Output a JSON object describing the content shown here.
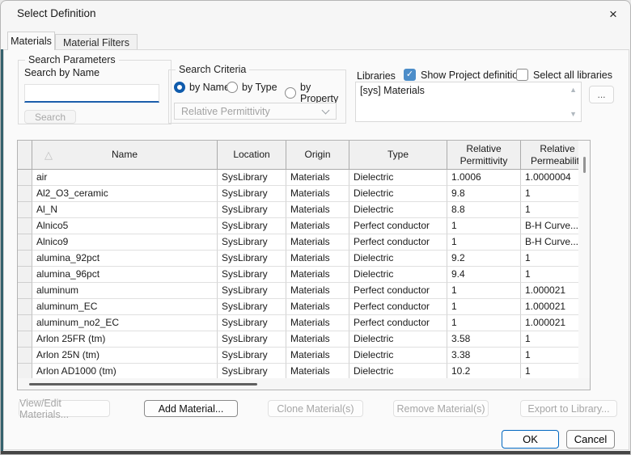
{
  "colors": {
    "accent_blue": "#0067c0",
    "radio_blue": "#0f5bac",
    "checkbox_blue": "#4c8dc9",
    "input_underline": "#1b5eab",
    "header_bg": "#f0f0f0"
  },
  "icons": {
    "close": "×",
    "check": "✓",
    "sort_ascending": "△",
    "scroll_up": "▲",
    "scroll_down": "▼"
  },
  "dialog": {
    "title": "Select Definition"
  },
  "tabs": {
    "materials": "Materials",
    "material_filters": "Material Filters",
    "active": "Materials"
  },
  "search_parameters": {
    "group_label": "Search Parameters",
    "field_label": "Search by Name",
    "input_value": "",
    "search_button": "Search",
    "search_enabled": false
  },
  "search_criteria": {
    "group_label": "Search Criteria",
    "by_name": "by Name",
    "by_type": "by Type",
    "by_property": "by Property",
    "selected_radio": "by Name",
    "property_dropdown_value": "Relative Permittivity",
    "property_dropdown_enabled": false
  },
  "libraries": {
    "label": "Libraries",
    "show_project_definitions_label": "Show Project definitions",
    "show_project_definitions_checked": true,
    "select_all_libraries_label": "Select all libraries",
    "select_all_libraries_checked": false,
    "items": [
      "[sys] Materials"
    ],
    "browse_button": "..."
  },
  "table": {
    "sort": {
      "column": "Name",
      "direction": "ascending"
    },
    "headers": {
      "name": "Name",
      "location": "Location",
      "origin": "Origin",
      "type": "Type",
      "rel_permittivity_line1": "Relative",
      "rel_permittivity_line2": "Permittivity",
      "rel_permeability_line1": "Relative",
      "rel_permeability_line2": "Permeability"
    },
    "rows": [
      {
        "name": "air",
        "location": "SysLibrary",
        "origin": "Materials",
        "type": "Dielectric",
        "rel_permittivity": "1.0006",
        "rel_permeability": "1.0000004"
      },
      {
        "name": "Al2_O3_ceramic",
        "location": "SysLibrary",
        "origin": "Materials",
        "type": "Dielectric",
        "rel_permittivity": "9.8",
        "rel_permeability": "1"
      },
      {
        "name": "Al_N",
        "location": "SysLibrary",
        "origin": "Materials",
        "type": "Dielectric",
        "rel_permittivity": "8.8",
        "rel_permeability": "1"
      },
      {
        "name": "Alnico5",
        "location": "SysLibrary",
        "origin": "Materials",
        "type": "Perfect conductor",
        "rel_permittivity": "1",
        "rel_permeability": "B-H Curve..."
      },
      {
        "name": "Alnico9",
        "location": "SysLibrary",
        "origin": "Materials",
        "type": "Perfect conductor",
        "rel_permittivity": "1",
        "rel_permeability": "B-H Curve..."
      },
      {
        "name": "alumina_92pct",
        "location": "SysLibrary",
        "origin": "Materials",
        "type": "Dielectric",
        "rel_permittivity": "9.2",
        "rel_permeability": "1"
      },
      {
        "name": "alumina_96pct",
        "location": "SysLibrary",
        "origin": "Materials",
        "type": "Dielectric",
        "rel_permittivity": "9.4",
        "rel_permeability": "1"
      },
      {
        "name": "aluminum",
        "location": "SysLibrary",
        "origin": "Materials",
        "type": "Perfect conductor",
        "rel_permittivity": "1",
        "rel_permeability": "1.000021"
      },
      {
        "name": "aluminum_EC",
        "location": "SysLibrary",
        "origin": "Materials",
        "type": "Perfect conductor",
        "rel_permittivity": "1",
        "rel_permeability": "1.000021"
      },
      {
        "name": "aluminum_no2_EC",
        "location": "SysLibrary",
        "origin": "Materials",
        "type": "Perfect conductor",
        "rel_permittivity": "1",
        "rel_permeability": "1.000021"
      },
      {
        "name": "Arlon 25FR (tm)",
        "location": "SysLibrary",
        "origin": "Materials",
        "type": "Dielectric",
        "rel_permittivity": "3.58",
        "rel_permeability": "1"
      },
      {
        "name": "Arlon 25N (tm)",
        "location": "SysLibrary",
        "origin": "Materials",
        "type": "Dielectric",
        "rel_permittivity": "3.38",
        "rel_permeability": "1"
      },
      {
        "name": "Arlon AD1000 (tm)",
        "location": "SysLibrary",
        "origin": "Materials",
        "type": "Dielectric",
        "rel_permittivity": "10.2",
        "rel_permeability": "1"
      }
    ]
  },
  "actions": [
    {
      "label": "View/Edit Materials...",
      "enabled": false
    },
    {
      "label": "Add Material...",
      "enabled": true
    },
    {
      "label": "Clone Material(s)",
      "enabled": false
    },
    {
      "label": "Remove Material(s)",
      "enabled": false
    },
    {
      "label": "Export to Library...",
      "enabled": false
    }
  ],
  "footer": {
    "ok_button": "OK",
    "cancel_button": "Cancel"
  }
}
